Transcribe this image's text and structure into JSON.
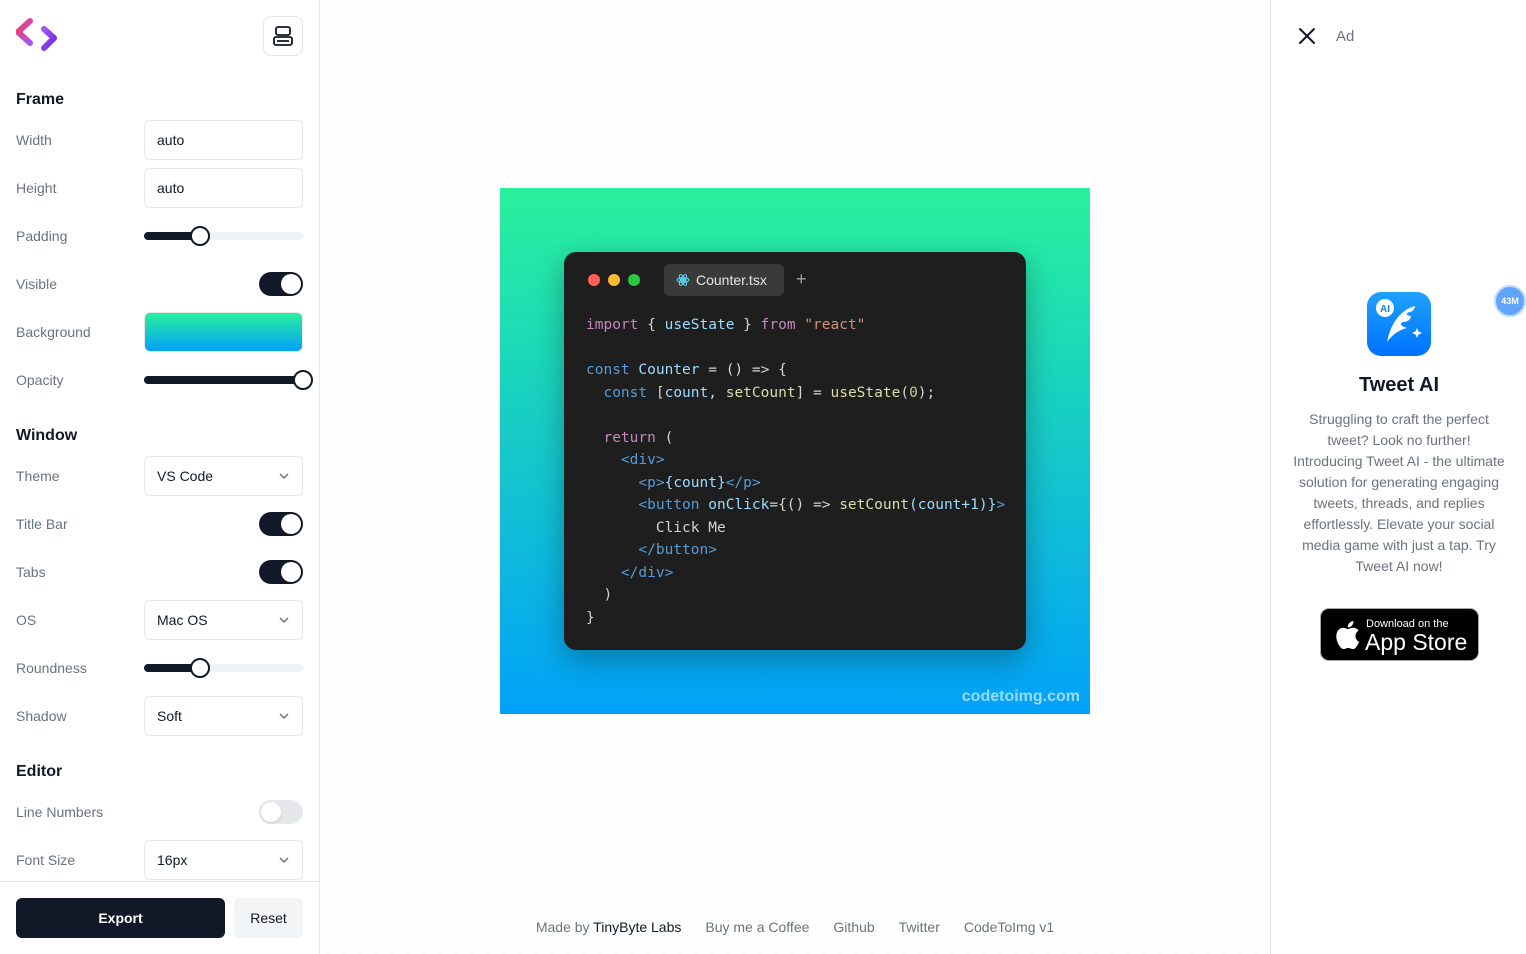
{
  "frame": {
    "title": "Frame",
    "width": {
      "label": "Width",
      "value": "auto"
    },
    "height": {
      "label": "Height",
      "value": "auto"
    },
    "padding": {
      "label": "Padding",
      "level": 0.35
    },
    "visible": {
      "label": "Visible",
      "on": true
    },
    "background": {
      "label": "Background",
      "from": "#29f19c",
      "to": "#02a1f9"
    },
    "opacity": {
      "label": "Opacity",
      "level": 1.0
    }
  },
  "window": {
    "title": "Window",
    "theme": {
      "label": "Theme",
      "value": "VS Code"
    },
    "title_bar": {
      "label": "Title Bar",
      "on": true
    },
    "tabs": {
      "label": "Tabs",
      "on": true
    },
    "os": {
      "label": "OS",
      "value": "Mac OS"
    },
    "roundness": {
      "label": "Roundness",
      "level": 0.35
    },
    "shadow": {
      "label": "Shadow",
      "value": "Soft"
    }
  },
  "editor": {
    "title": "Editor",
    "line_numbers": {
      "label": "Line Numbers",
      "on": false
    },
    "font_size": {
      "label": "Font Size",
      "value": "16px"
    }
  },
  "actions": {
    "export": "Export",
    "reset": "Reset"
  },
  "preview": {
    "tab_name": "Counter.tsx",
    "tab_icon": "react-icon",
    "add_tab": "+",
    "watermark": "codetoimg.com",
    "code": {
      "l1_import": "import",
      "l1_open": " { ",
      "l1_ident": "useState",
      "l1_close": " } ",
      "l1_from": "from",
      "l1_str": " \"react\"",
      "l3_const": "const",
      "l3_name": " Counter",
      "l3_rest": " = () => {",
      "l4_indent": "  ",
      "l4_const": "const",
      "l4_open": " [",
      "l4_count": "count",
      "l4_comma": ", ",
      "l4_set": "setCount",
      "l4_eq": "] = ",
      "l4_use": "useState",
      "l4_po": "(",
      "l4_zero": "0",
      "l4_pc": ");",
      "l6_indent": "  ",
      "l6_return": "return",
      "l6_paren": " (",
      "l7_indent": "    ",
      "l7_tag": "<div>",
      "l8_indent": "      ",
      "l8_p_open": "<p>",
      "l8_expr": "{count}",
      "l8_p_close": "</p>",
      "l9_indent": "      ",
      "l9_btn": "<button",
      "l9_attr": " onClick",
      "l9_eq": "={() => ",
      "l9_fn": "setCount",
      "l9_args": "(count+1)}",
      "l9_gt": ">",
      "l10_indent": "        ",
      "l10_text": "Click Me",
      "l11_indent": "      ",
      "l11_tag": "</button>",
      "l12_indent": "    ",
      "l12_tag": "</div>",
      "l13_text": "  )",
      "l14_text": "}"
    }
  },
  "footer": {
    "made_by_prefix": "Made by",
    "made_by_name": "TinyByte Labs",
    "links": [
      "Buy me a Coffee",
      "Github",
      "Twitter",
      "CodeToImg v1"
    ]
  },
  "ad": {
    "label": "Ad",
    "app_name": "Tweet AI",
    "description": "Struggling to craft the perfect tweet? Look no further! Introducing Tweet AI - the ultimate solution for generating engaging tweets, threads, and replies effortlessly. Elevate your social media game with just a tap. Try Tweet AI now!",
    "store_small": "Download on the",
    "store_big": "App Store",
    "badge": "43M",
    "icon_badge": "AI"
  },
  "colors": {
    "accent": "#111827",
    "gradient_top": "#29f19c",
    "gradient_bottom": "#02a1f9"
  }
}
